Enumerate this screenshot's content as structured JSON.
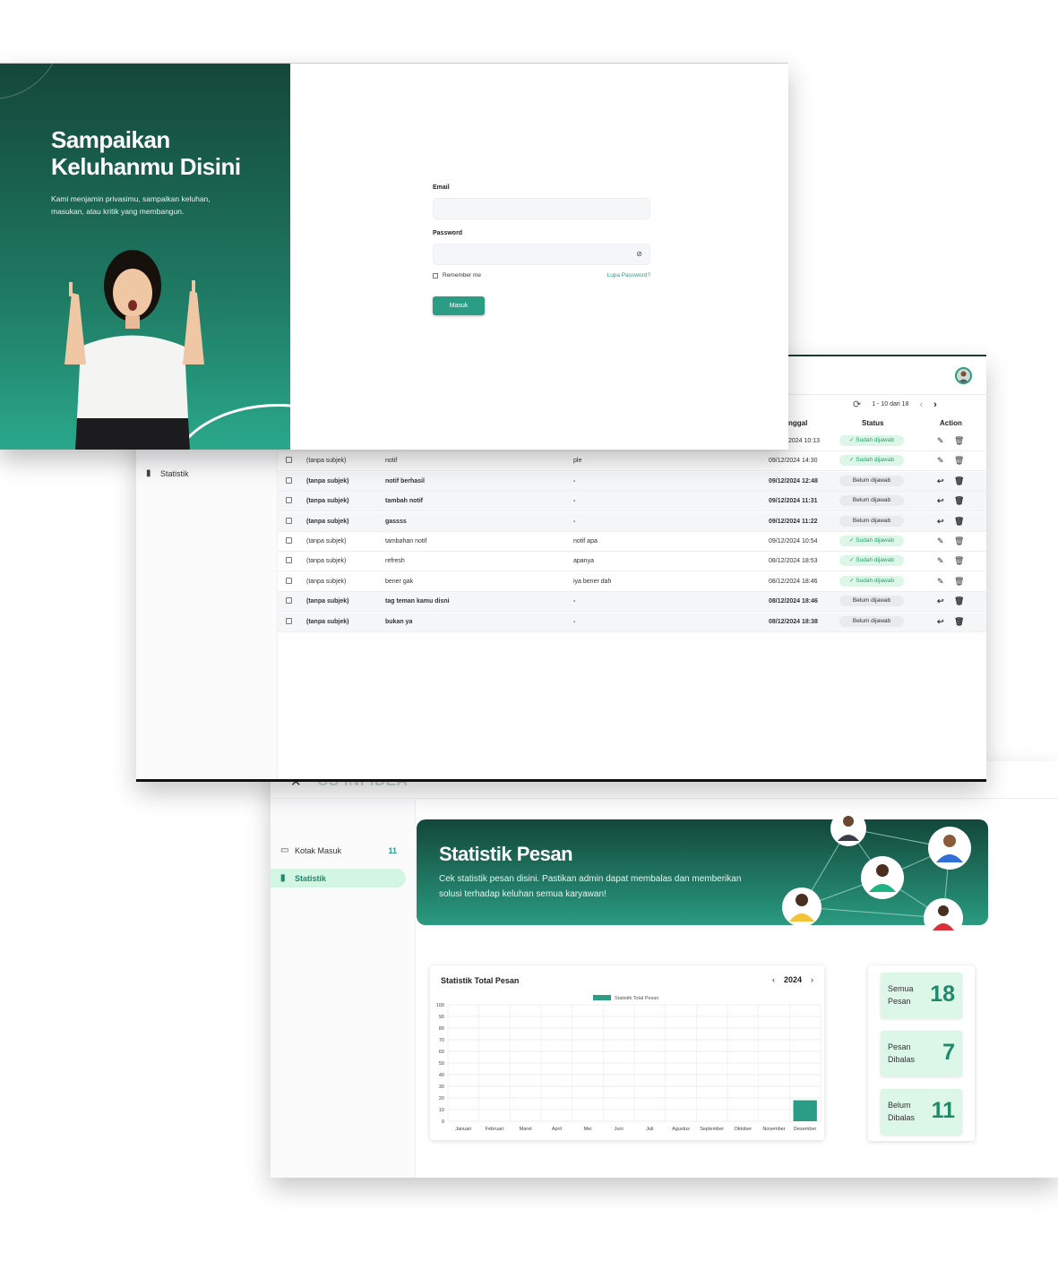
{
  "login": {
    "hero_title": "Sampaikan Keluhanmu Disini",
    "hero_subtitle": "Kami menjamin privasimu, sampaikan keluhan, masukan, atau kritik yang membangun.",
    "email_label": "Email",
    "password_label": "Password",
    "remember_label": "Remember me",
    "forgot_label": "Lupa Password?",
    "submit_label": "Masuk"
  },
  "inbox": {
    "sidebar": {
      "stats_label": "Statistik"
    },
    "pager": {
      "range": "1 - 10 dari 18"
    },
    "columns": {
      "date": "nggal",
      "status": "Status",
      "action": "Action"
    },
    "rows": [
      {
        "subject": "",
        "title": "",
        "preview": "",
        "date": "2024 10:13",
        "status": "Sudah dijawab",
        "answered": true,
        "unread": false
      },
      {
        "subject": "(tanpa subjek)",
        "title": "notif",
        "preview": "ple",
        "date": "09/12/2024 14:30",
        "status": "Sudah dijawab",
        "answered": true,
        "unread": false
      },
      {
        "subject": "(tanpa subjek)",
        "title": "notif berhasil",
        "preview": "-",
        "date": "09/12/2024 12:48",
        "status": "Belum dijawab",
        "answered": false,
        "unread": true
      },
      {
        "subject": "(tanpa subjek)",
        "title": "tambah notif",
        "preview": "-",
        "date": "09/12/2024 11:31",
        "status": "Belum dijawab",
        "answered": false,
        "unread": true
      },
      {
        "subject": "(tanpa subjek)",
        "title": "gassss",
        "preview": "-",
        "date": "09/12/2024 11:22",
        "status": "Belum dijawab",
        "answered": false,
        "unread": true
      },
      {
        "subject": "(tanpa subjek)",
        "title": "tambahan notif",
        "preview": "notif apa",
        "date": "09/12/2024 10:54",
        "status": "Sudah dijawab",
        "answered": true,
        "unread": false
      },
      {
        "subject": "(tanpa subjek)",
        "title": "refresh",
        "preview": "apanya",
        "date": "08/12/2024 18:53",
        "status": "Sudah dijawab",
        "answered": true,
        "unread": false
      },
      {
        "subject": "(tanpa subjek)",
        "title": "bener gak",
        "preview": "iya bener dah",
        "date": "08/12/2024 18:46",
        "status": "Sudah dijawab",
        "answered": true,
        "unread": false
      },
      {
        "subject": "(tanpa subjek)",
        "title": "tag teman kamu disni",
        "preview": "-",
        "date": "08/12/2024 18:46",
        "status": "Belum dijawab",
        "answered": false,
        "unread": true
      },
      {
        "subject": "(tanpa subjek)",
        "title": "bukan ya",
        "preview": "-",
        "date": "08/12/2024 18:38",
        "status": "Belum dijawab",
        "answered": false,
        "unread": true
      }
    ]
  },
  "stats": {
    "brand": "CS INFIDEA",
    "sidebar": {
      "inbox_label": "Kotak Masuk",
      "inbox_count": "11",
      "stats_label": "Statistik"
    },
    "banner": {
      "title": "Statistik Pesan",
      "subtitle": "Cek statistik pesan disini. Pastikan admin dapat membalas dan memberikan solusi terhadap keluhan semua karyawan!"
    },
    "chart_card_title": "Statistik Total Pesan",
    "year": "2024",
    "cards": [
      {
        "label": "Semua Pesan",
        "value": "18"
      },
      {
        "label": "Pesan Dibalas",
        "value": "7"
      },
      {
        "label": "Belum Dibalas",
        "value": "11"
      }
    ]
  },
  "colors": {
    "accent": "#2a9d84",
    "dark_green": "#14473a",
    "mint": "#dcf6e7"
  },
  "chart_data": {
    "type": "bar",
    "categories": [
      "Januari",
      "Februari",
      "Maret",
      "April",
      "Mei",
      "Juni",
      "Juli",
      "Agustus",
      "September",
      "Oktober",
      "November",
      "Desember"
    ],
    "series": [
      {
        "name": "Statistik Total Pesan",
        "values": [
          0,
          0,
          0,
          0,
          0,
          0,
          0,
          0,
          0,
          0,
          0,
          18
        ]
      }
    ],
    "yticks": [
      0,
      10,
      20,
      30,
      40,
      50,
      60,
      70,
      80,
      90,
      100
    ],
    "ylim": [
      0,
      100
    ],
    "grid": true,
    "legend": "top-center",
    "color": "#2a9d84"
  }
}
